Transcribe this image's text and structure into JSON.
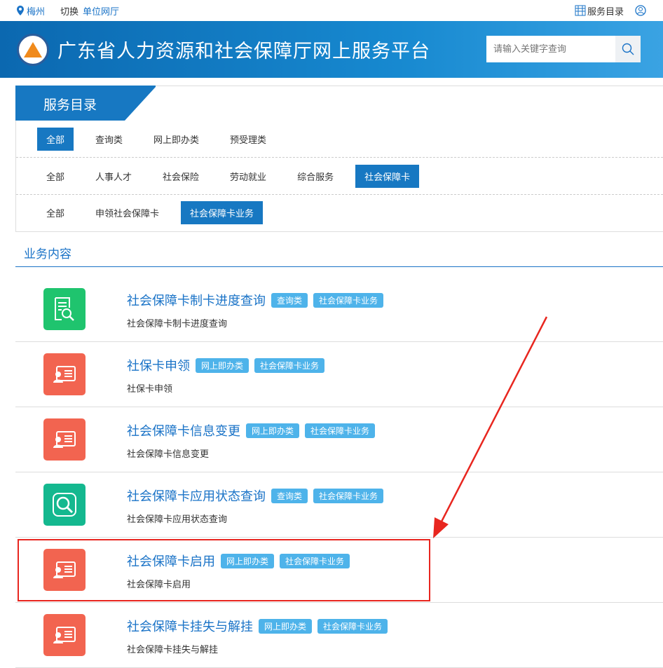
{
  "topbar": {
    "city": "梅州",
    "switch": "切换",
    "unit_hall": "单位网厅",
    "catalog": "服务目录"
  },
  "banner": {
    "title": "广东省人力资源和社会保障厅网上服务平台",
    "search_placeholder": "请输入关键字查询"
  },
  "catalog": {
    "title": "服务目录",
    "row1": [
      "全部",
      "查询类",
      "网上即办类",
      "预受理类"
    ],
    "row2": [
      "全部",
      "人事人才",
      "社会保险",
      "劳动就业",
      "综合服务",
      "社会保障卡"
    ],
    "row3": [
      "全部",
      "申领社会保障卡",
      "社会保障卡业务"
    ]
  },
  "section_title": "业务内容",
  "items": [
    {
      "title": "社会保障卡制卡进度查询",
      "tags": [
        "查询类",
        "社会保障卡业务"
      ],
      "desc": "社会保障卡制卡进度查询",
      "icon": "document-search",
      "color": "#1fc46e"
    },
    {
      "title": "社保卡申领",
      "tags": [
        "网上即办类",
        "社会保障卡业务"
      ],
      "desc": "社保卡申领",
      "icon": "id-card",
      "color": "#f26450"
    },
    {
      "title": "社会保障卡信息变更",
      "tags": [
        "网上即办类",
        "社会保障卡业务"
      ],
      "desc": "社会保障卡信息变更",
      "icon": "id-card",
      "color": "#f26450"
    },
    {
      "title": "社会保障卡应用状态查询",
      "tags": [
        "查询类",
        "社会保障卡业务"
      ],
      "desc": "社会保障卡应用状态查询",
      "icon": "magnifier",
      "color": "#14b88f"
    },
    {
      "title": "社会保障卡启用",
      "tags": [
        "网上即办类",
        "社会保障卡业务"
      ],
      "desc": "社会保障卡启用",
      "icon": "id-card",
      "color": "#f26450"
    },
    {
      "title": "社会保障卡挂失与解挂",
      "tags": [
        "网上即办类",
        "社会保障卡业务"
      ],
      "desc": "社会保障卡挂失与解挂",
      "icon": "id-card",
      "color": "#f26450"
    }
  ]
}
